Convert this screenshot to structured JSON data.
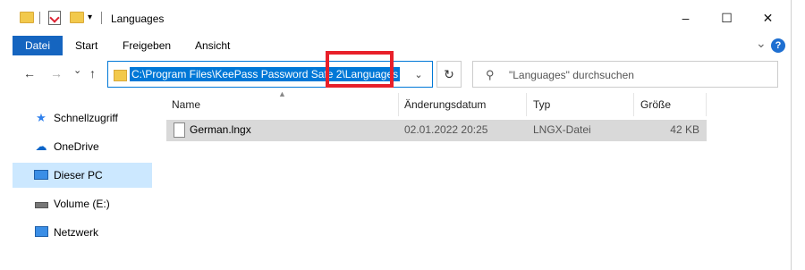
{
  "window": {
    "title": "Languages",
    "controls": {
      "minimize": "–",
      "maximize": "☐",
      "close": "✕"
    }
  },
  "ribbon": {
    "tabs": [
      "Datei",
      "Start",
      "Freigeben",
      "Ansicht"
    ],
    "expand": "⌄",
    "help": "?"
  },
  "nav": {
    "back": "←",
    "forward": "→",
    "recent": "⌄",
    "up": "↑",
    "address_value": "C:\\Program Files\\KeePass Password Safe 2\\Languages",
    "address_dropdown": "⌄",
    "refresh": "↻",
    "search_placeholder": "\"Languages\" durchsuchen"
  },
  "sidebar": {
    "items": [
      {
        "label": "Schnellzugriff",
        "icon": "star-icon"
      },
      {
        "label": "OneDrive",
        "icon": "cloud-icon"
      },
      {
        "label": "Dieser PC",
        "icon": "computer-icon",
        "selected": true
      },
      {
        "label": "Volume (E:)",
        "icon": "drive-icon"
      },
      {
        "label": "Netzwerk",
        "icon": "network-icon"
      }
    ]
  },
  "table": {
    "columns": [
      "Name",
      "Änderungsdatum",
      "Typ",
      "Größe"
    ],
    "rows": [
      {
        "name": "German.lngx",
        "date": "02.01.2022 20:25",
        "type": "LNGX-Datei",
        "size": "42 KB"
      }
    ]
  },
  "colors": {
    "accent": "#0078d7",
    "file_tab": "#1565c0",
    "selection": "#cce8ff",
    "annotation": "#e8202a"
  }
}
